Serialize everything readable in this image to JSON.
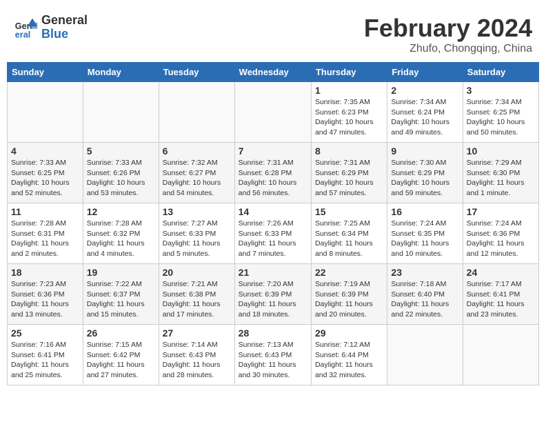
{
  "header": {
    "logo_general": "General",
    "logo_blue": "Blue",
    "month_year": "February 2024",
    "location": "Zhufo, Chongqing, China"
  },
  "weekdays": [
    "Sunday",
    "Monday",
    "Tuesday",
    "Wednesday",
    "Thursday",
    "Friday",
    "Saturday"
  ],
  "weeks": [
    [
      {
        "day": "",
        "sunrise": "",
        "sunset": "",
        "daylight": ""
      },
      {
        "day": "",
        "sunrise": "",
        "sunset": "",
        "daylight": ""
      },
      {
        "day": "",
        "sunrise": "",
        "sunset": "",
        "daylight": ""
      },
      {
        "day": "",
        "sunrise": "",
        "sunset": "",
        "daylight": ""
      },
      {
        "day": "1",
        "sunrise": "Sunrise: 7:35 AM",
        "sunset": "Sunset: 6:23 PM",
        "daylight": "Daylight: 10 hours and 47 minutes."
      },
      {
        "day": "2",
        "sunrise": "Sunrise: 7:34 AM",
        "sunset": "Sunset: 6:24 PM",
        "daylight": "Daylight: 10 hours and 49 minutes."
      },
      {
        "day": "3",
        "sunrise": "Sunrise: 7:34 AM",
        "sunset": "Sunset: 6:25 PM",
        "daylight": "Daylight: 10 hours and 50 minutes."
      }
    ],
    [
      {
        "day": "4",
        "sunrise": "Sunrise: 7:33 AM",
        "sunset": "Sunset: 6:25 PM",
        "daylight": "Daylight: 10 hours and 52 minutes."
      },
      {
        "day": "5",
        "sunrise": "Sunrise: 7:33 AM",
        "sunset": "Sunset: 6:26 PM",
        "daylight": "Daylight: 10 hours and 53 minutes."
      },
      {
        "day": "6",
        "sunrise": "Sunrise: 7:32 AM",
        "sunset": "Sunset: 6:27 PM",
        "daylight": "Daylight: 10 hours and 54 minutes."
      },
      {
        "day": "7",
        "sunrise": "Sunrise: 7:31 AM",
        "sunset": "Sunset: 6:28 PM",
        "daylight": "Daylight: 10 hours and 56 minutes."
      },
      {
        "day": "8",
        "sunrise": "Sunrise: 7:31 AM",
        "sunset": "Sunset: 6:29 PM",
        "daylight": "Daylight: 10 hours and 57 minutes."
      },
      {
        "day": "9",
        "sunrise": "Sunrise: 7:30 AM",
        "sunset": "Sunset: 6:29 PM",
        "daylight": "Daylight: 10 hours and 59 minutes."
      },
      {
        "day": "10",
        "sunrise": "Sunrise: 7:29 AM",
        "sunset": "Sunset: 6:30 PM",
        "daylight": "Daylight: 11 hours and 1 minute."
      }
    ],
    [
      {
        "day": "11",
        "sunrise": "Sunrise: 7:28 AM",
        "sunset": "Sunset: 6:31 PM",
        "daylight": "Daylight: 11 hours and 2 minutes."
      },
      {
        "day": "12",
        "sunrise": "Sunrise: 7:28 AM",
        "sunset": "Sunset: 6:32 PM",
        "daylight": "Daylight: 11 hours and 4 minutes."
      },
      {
        "day": "13",
        "sunrise": "Sunrise: 7:27 AM",
        "sunset": "Sunset: 6:33 PM",
        "daylight": "Daylight: 11 hours and 5 minutes."
      },
      {
        "day": "14",
        "sunrise": "Sunrise: 7:26 AM",
        "sunset": "Sunset: 6:33 PM",
        "daylight": "Daylight: 11 hours and 7 minutes."
      },
      {
        "day": "15",
        "sunrise": "Sunrise: 7:25 AM",
        "sunset": "Sunset: 6:34 PM",
        "daylight": "Daylight: 11 hours and 8 minutes."
      },
      {
        "day": "16",
        "sunrise": "Sunrise: 7:24 AM",
        "sunset": "Sunset: 6:35 PM",
        "daylight": "Daylight: 11 hours and 10 minutes."
      },
      {
        "day": "17",
        "sunrise": "Sunrise: 7:24 AM",
        "sunset": "Sunset: 6:36 PM",
        "daylight": "Daylight: 11 hours and 12 minutes."
      }
    ],
    [
      {
        "day": "18",
        "sunrise": "Sunrise: 7:23 AM",
        "sunset": "Sunset: 6:36 PM",
        "daylight": "Daylight: 11 hours and 13 minutes."
      },
      {
        "day": "19",
        "sunrise": "Sunrise: 7:22 AM",
        "sunset": "Sunset: 6:37 PM",
        "daylight": "Daylight: 11 hours and 15 minutes."
      },
      {
        "day": "20",
        "sunrise": "Sunrise: 7:21 AM",
        "sunset": "Sunset: 6:38 PM",
        "daylight": "Daylight: 11 hours and 17 minutes."
      },
      {
        "day": "21",
        "sunrise": "Sunrise: 7:20 AM",
        "sunset": "Sunset: 6:39 PM",
        "daylight": "Daylight: 11 hours and 18 minutes."
      },
      {
        "day": "22",
        "sunrise": "Sunrise: 7:19 AM",
        "sunset": "Sunset: 6:39 PM",
        "daylight": "Daylight: 11 hours and 20 minutes."
      },
      {
        "day": "23",
        "sunrise": "Sunrise: 7:18 AM",
        "sunset": "Sunset: 6:40 PM",
        "daylight": "Daylight: 11 hours and 22 minutes."
      },
      {
        "day": "24",
        "sunrise": "Sunrise: 7:17 AM",
        "sunset": "Sunset: 6:41 PM",
        "daylight": "Daylight: 11 hours and 23 minutes."
      }
    ],
    [
      {
        "day": "25",
        "sunrise": "Sunrise: 7:16 AM",
        "sunset": "Sunset: 6:41 PM",
        "daylight": "Daylight: 11 hours and 25 minutes."
      },
      {
        "day": "26",
        "sunrise": "Sunrise: 7:15 AM",
        "sunset": "Sunset: 6:42 PM",
        "daylight": "Daylight: 11 hours and 27 minutes."
      },
      {
        "day": "27",
        "sunrise": "Sunrise: 7:14 AM",
        "sunset": "Sunset: 6:43 PM",
        "daylight": "Daylight: 11 hours and 28 minutes."
      },
      {
        "day": "28",
        "sunrise": "Sunrise: 7:13 AM",
        "sunset": "Sunset: 6:43 PM",
        "daylight": "Daylight: 11 hours and 30 minutes."
      },
      {
        "day": "29",
        "sunrise": "Sunrise: 7:12 AM",
        "sunset": "Sunset: 6:44 PM",
        "daylight": "Daylight: 11 hours and 32 minutes."
      },
      {
        "day": "",
        "sunrise": "",
        "sunset": "",
        "daylight": ""
      },
      {
        "day": "",
        "sunrise": "",
        "sunset": "",
        "daylight": ""
      }
    ]
  ]
}
